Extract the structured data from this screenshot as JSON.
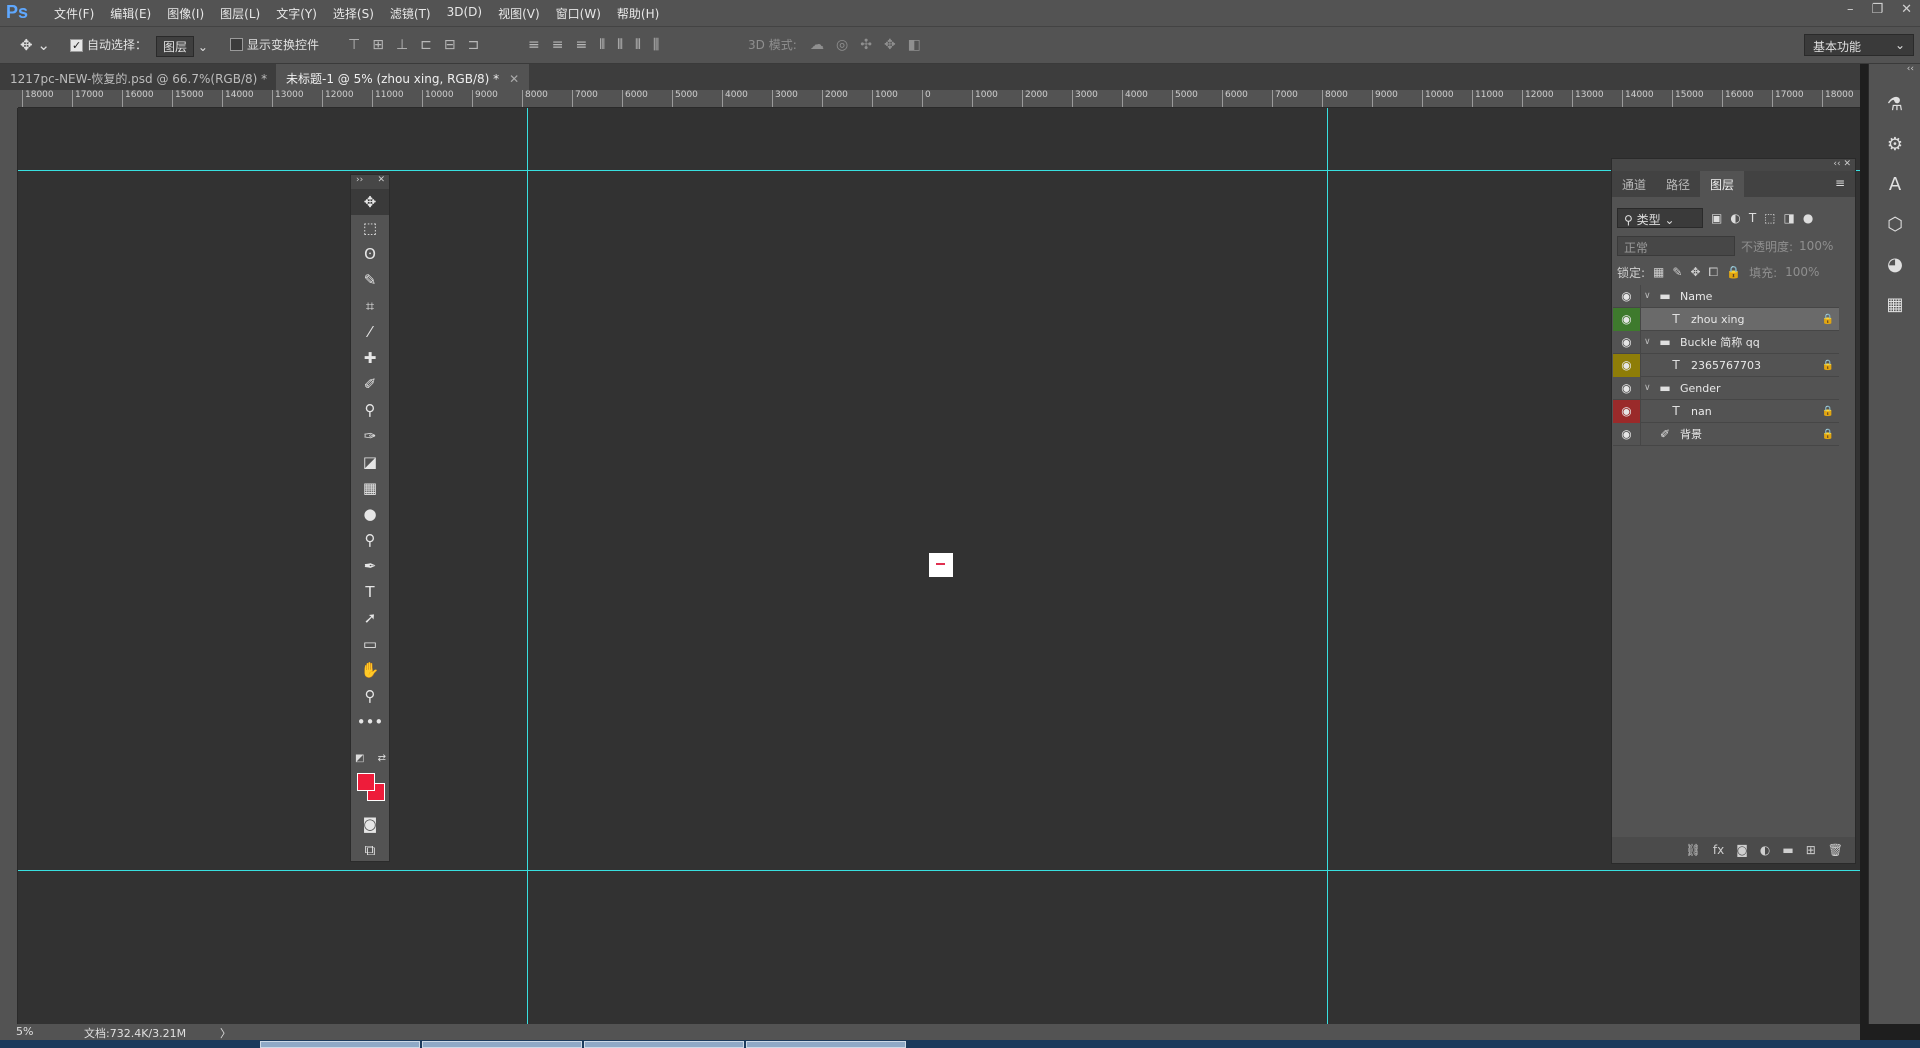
{
  "app": {
    "logo": "Ps"
  },
  "menu": [
    "文件(F)",
    "编辑(E)",
    "图像(I)",
    "图层(L)",
    "文字(Y)",
    "选择(S)",
    "滤镜(T)",
    "3D(D)",
    "视图(V)",
    "窗口(W)",
    "帮助(H)"
  ],
  "window_controls": [
    "minimize",
    "restore",
    "close"
  ],
  "options": {
    "auto_select_label": "自动选择：",
    "auto_select_checked": true,
    "auto_select_value": "图层",
    "show_transform_label": "显示变换控件",
    "show_transform_checked": false,
    "mode_3d_label": "3D 模式:",
    "workspace": "基本功能"
  },
  "tabs": [
    {
      "label": "1217pc-NEW-恢复的.psd @ 66.7%(RGB/8) *",
      "active": false
    },
    {
      "label": "未标题-1 @ 5% (zhou  xing, RGB/8) *",
      "active": true
    }
  ],
  "ruler_top": [
    "18000",
    "17000",
    "16000",
    "15000",
    "14000",
    "13000",
    "12000",
    "11000",
    "10000",
    "9000",
    "8000",
    "7000",
    "6000",
    "5000",
    "4000",
    "3000",
    "2000",
    "1000",
    "0",
    "1000",
    "2000",
    "3000",
    "4000",
    "5000",
    "6000",
    "7000",
    "8000",
    "9000",
    "10000",
    "11000",
    "12000",
    "13000",
    "14000",
    "15000",
    "16000",
    "17000",
    "18000"
  ],
  "tools": [
    {
      "icon": "move-tool-icon",
      "glyph": "✥"
    },
    {
      "icon": "marquee-tool-icon",
      "glyph": "⬚"
    },
    {
      "icon": "lasso-tool-icon",
      "glyph": "ʘ"
    },
    {
      "icon": "quick-select-tool-icon",
      "glyph": "✎"
    },
    {
      "icon": "crop-tool-icon",
      "glyph": "⌗"
    },
    {
      "icon": "eyedropper-tool-icon",
      "glyph": "⁄"
    },
    {
      "icon": "healing-brush-tool-icon",
      "glyph": "✚"
    },
    {
      "icon": "brush-tool-icon",
      "glyph": "✐"
    },
    {
      "icon": "stamp-tool-icon",
      "glyph": "⚲"
    },
    {
      "icon": "history-brush-tool-icon",
      "glyph": "✑"
    },
    {
      "icon": "eraser-tool-icon",
      "glyph": "◪"
    },
    {
      "icon": "gradient-tool-icon",
      "glyph": "▦"
    },
    {
      "icon": "blur-tool-icon",
      "glyph": "●"
    },
    {
      "icon": "dodge-tool-icon",
      "glyph": "⚲"
    },
    {
      "icon": "pen-tool-icon",
      "glyph": "✒"
    },
    {
      "icon": "type-tool-icon",
      "glyph": "T"
    },
    {
      "icon": "path-select-tool-icon",
      "glyph": "➚"
    },
    {
      "icon": "rectangle-tool-icon",
      "glyph": "▭"
    },
    {
      "icon": "hand-tool-icon",
      "glyph": "✋"
    },
    {
      "icon": "zoom-tool-icon",
      "glyph": "⚲"
    },
    {
      "icon": "more-tools-icon",
      "glyph": "•••"
    }
  ],
  "colors": {
    "foreground": "#ee1c3a",
    "background": "#ee1c3a",
    "guide": "#38e0e0"
  },
  "layers_panel": {
    "tabs": [
      {
        "label": "通道",
        "active": false
      },
      {
        "label": "路径",
        "active": false
      },
      {
        "label": "图层",
        "active": true
      }
    ],
    "filter_kind": "类型",
    "blend_mode": "正常",
    "opacity_label": "不透明度:",
    "opacity_value": "100%",
    "lock_label": "锁定:",
    "fill_label": "填充:",
    "fill_value": "100%",
    "layers": [
      {
        "name": "Name",
        "kind": "group",
        "indent": 0,
        "eye_color": "none",
        "locked": false,
        "selected": false
      },
      {
        "name": "zhou  xing",
        "kind": "text",
        "indent": 1,
        "eye_color": "green",
        "locked": true,
        "selected": true
      },
      {
        "name": "Buckle 简称 qq",
        "kind": "group",
        "indent": 0,
        "eye_color": "none",
        "locked": false,
        "selected": false
      },
      {
        "name": "2365767703",
        "kind": "text",
        "indent": 1,
        "eye_color": "yellow",
        "locked": true,
        "selected": false
      },
      {
        "name": "Gender",
        "kind": "group",
        "indent": 0,
        "eye_color": "none",
        "locked": false,
        "selected": false
      },
      {
        "name": "nan",
        "kind": "text",
        "indent": 1,
        "eye_color": "red",
        "locked": true,
        "selected": false
      },
      {
        "name": "背景",
        "kind": "background",
        "indent": 0,
        "eye_color": "none",
        "locked": true,
        "selected": false
      }
    ],
    "footer_icons": [
      "link-layers-icon",
      "fx-icon",
      "add-mask-icon",
      "adjustment-layer-icon",
      "new-group-icon",
      "new-layer-icon",
      "delete-layer-icon"
    ]
  },
  "status": {
    "zoom": "5%",
    "doc_size": "文档:732.4K/3.21M",
    "arrow": "〉"
  }
}
